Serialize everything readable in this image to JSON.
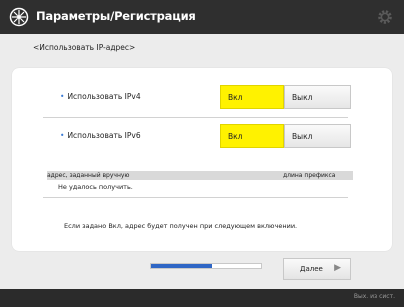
{
  "header": {
    "title": "Параметры/Регистрация",
    "gear_icon": "gear-icon",
    "title_icon": "settings-wheel-icon"
  },
  "subtitle": "<Использовать IP-адрес>",
  "ipv4": {
    "label": "Использовать IPv4",
    "on_label": "Вкл",
    "off_label": "Выкл",
    "selected": "on"
  },
  "ipv6": {
    "label": "Использовать IPv6",
    "on_label": "Вкл",
    "off_label": "Выкл",
    "selected": "on"
  },
  "info": {
    "header_left": "адрес, заданный вручную",
    "header_right": "длина префикса",
    "value": "Не удалось получить.",
    "note": "Если задано Вкл, адрес будет получен при следующем включении."
  },
  "footer": {
    "progress": 0.55,
    "next_label": "Далее",
    "next_arrow": "▶",
    "status": "Вых. из сист."
  },
  "colors": {
    "accent": "#fff200",
    "progress": "#2f66c5",
    "topbar": "#2f2f2f"
  }
}
